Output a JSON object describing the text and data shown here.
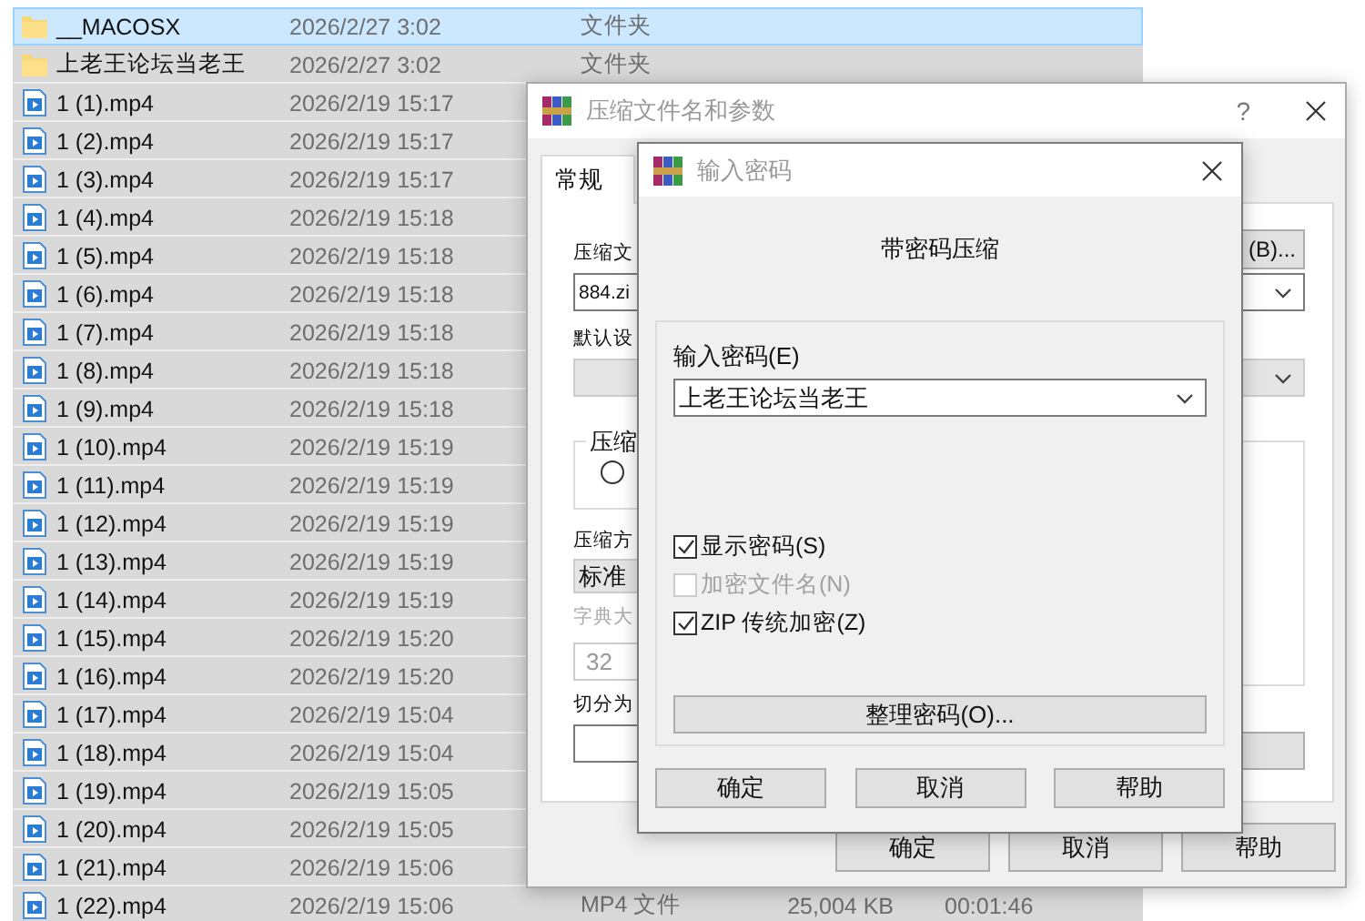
{
  "file_list": {
    "rows": [
      {
        "kind": "folder",
        "name": "__MACOSX",
        "date": "2026/2/27 3:02",
        "type": "文件夹",
        "selected": true,
        "focused": true
      },
      {
        "kind": "folder",
        "name": "上老王论坛当老王",
        "date": "2026/2/27 3:02",
        "type": "文件夹",
        "selected": true,
        "focused": false
      },
      {
        "kind": "video",
        "name": "1 (1).mp4",
        "date": "2026/2/19 15:17",
        "selected": true,
        "focused": false
      },
      {
        "kind": "video",
        "name": "1 (2).mp4",
        "date": "2026/2/19 15:17",
        "selected": true,
        "focused": false
      },
      {
        "kind": "video",
        "name": "1 (3).mp4",
        "date": "2026/2/19 15:17",
        "selected": true,
        "focused": false
      },
      {
        "kind": "video",
        "name": "1 (4).mp4",
        "date": "2026/2/19 15:18",
        "selected": true,
        "focused": false
      },
      {
        "kind": "video",
        "name": "1 (5).mp4",
        "date": "2026/2/19 15:18",
        "selected": true,
        "focused": false
      },
      {
        "kind": "video",
        "name": "1 (6).mp4",
        "date": "2026/2/19 15:18",
        "selected": true,
        "focused": false
      },
      {
        "kind": "video",
        "name": "1 (7).mp4",
        "date": "2026/2/19 15:18",
        "selected": true,
        "focused": false
      },
      {
        "kind": "video",
        "name": "1 (8).mp4",
        "date": "2026/2/19 15:18",
        "selected": true,
        "focused": false
      },
      {
        "kind": "video",
        "name": "1 (9).mp4",
        "date": "2026/2/19 15:18",
        "selected": true,
        "focused": false
      },
      {
        "kind": "video",
        "name": "1 (10).mp4",
        "date": "2026/2/19 15:19",
        "selected": true,
        "focused": false
      },
      {
        "kind": "video",
        "name": "1 (11).mp4",
        "date": "2026/2/19 15:19",
        "selected": true,
        "focused": false
      },
      {
        "kind": "video",
        "name": "1 (12).mp4",
        "date": "2026/2/19 15:19",
        "selected": true,
        "focused": false
      },
      {
        "kind": "video",
        "name": "1 (13).mp4",
        "date": "2026/2/19 15:19",
        "selected": true,
        "focused": false
      },
      {
        "kind": "video",
        "name": "1 (14).mp4",
        "date": "2026/2/19 15:19",
        "selected": true,
        "focused": false
      },
      {
        "kind": "video",
        "name": "1 (15).mp4",
        "date": "2026/2/19 15:20",
        "selected": true,
        "focused": false
      },
      {
        "kind": "video",
        "name": "1 (16).mp4",
        "date": "2026/2/19 15:20",
        "selected": true,
        "focused": false
      },
      {
        "kind": "video",
        "name": "1 (17).mp4",
        "date": "2026/2/19 15:04",
        "selected": true,
        "focused": false
      },
      {
        "kind": "video",
        "name": "1 (18).mp4",
        "date": "2026/2/19 15:04",
        "selected": true,
        "focused": false
      },
      {
        "kind": "video",
        "name": "1 (19).mp4",
        "date": "2026/2/19 15:05",
        "selected": true,
        "focused": false
      },
      {
        "kind": "video",
        "name": "1 (20).mp4",
        "date": "2026/2/19 15:05",
        "selected": true,
        "focused": false
      },
      {
        "kind": "video",
        "name": "1 (21).mp4",
        "date": "2026/2/19 15:06",
        "selected": true,
        "focused": false
      },
      {
        "kind": "video",
        "name": "1 (22).mp4",
        "date": "2026/2/19 15:06",
        "type": "MP4 文件",
        "size": "25,004 KB",
        "duration": "00:01:46",
        "selected": true,
        "focused": false
      }
    ]
  },
  "archive_dialog": {
    "title": "压缩文件名和参数",
    "help": "?",
    "tabs": [
      {
        "label": "常规",
        "selected": true
      }
    ],
    "archive_label": "压缩文",
    "browse_button": "(B)...",
    "archive_name": "884.zi",
    "profile_label": "默认设",
    "format_group": "压缩",
    "format_radio": {
      "selected": false
    },
    "method_label": "压缩方",
    "method": "标准",
    "dict_label": "字典大",
    "dict_value": "32",
    "dict_disabled": true,
    "split_label": "切分为",
    "buttons": [
      "确定",
      "取消",
      "帮助"
    ]
  },
  "password_dialog": {
    "title": "输入密码",
    "heading": "带密码压缩",
    "password_label": "输入密码(E)",
    "password": "上老王论坛当老王",
    "options": [
      {
        "label": "显示密码(S)",
        "checked": true,
        "disabled": false
      },
      {
        "label": "加密文件名(N)",
        "checked": false,
        "disabled": true
      },
      {
        "label": "ZIP 传统加密(Z)",
        "checked": true,
        "disabled": false
      }
    ],
    "organize_button": "整理密码(O)...",
    "buttons": [
      "确定",
      "取消",
      "帮助"
    ]
  }
}
